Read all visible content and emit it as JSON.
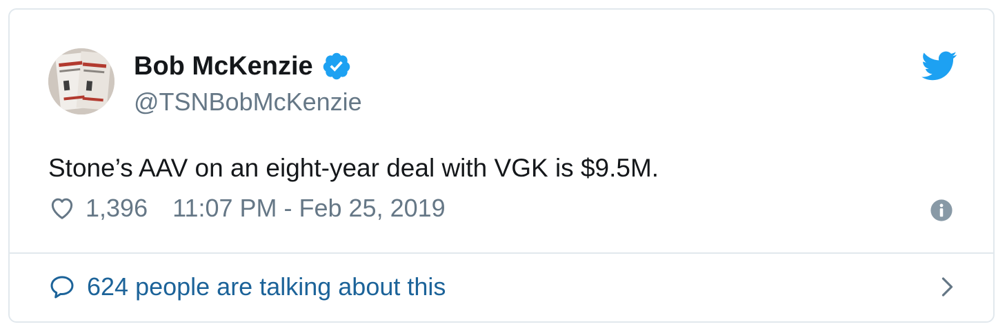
{
  "author": {
    "display_name": "Bob McKenzie",
    "handle": "@TSNBobMcKenzie",
    "verified": true,
    "avatar_icon": "avatar-book-cover"
  },
  "tweet": {
    "text": "Stone’s AAV on an eight-year deal with VGK is $9.5M.",
    "like_count": "1,396",
    "timestamp": "11:07 PM - Feb 25, 2019"
  },
  "footer": {
    "conversation_text": "624 people are talking about this"
  },
  "icons": {
    "brand": "twitter-bird-icon",
    "verified": "verified-badge-icon",
    "like": "heart-icon",
    "info": "info-icon",
    "reply": "speech-bubble-icon",
    "chevron": "chevron-right-icon"
  },
  "colors": {
    "brand_blue": "#1da1f2",
    "text_primary": "#14171a",
    "text_secondary": "#657786",
    "link_blue": "#1c6399",
    "border": "#e1e8ed"
  }
}
